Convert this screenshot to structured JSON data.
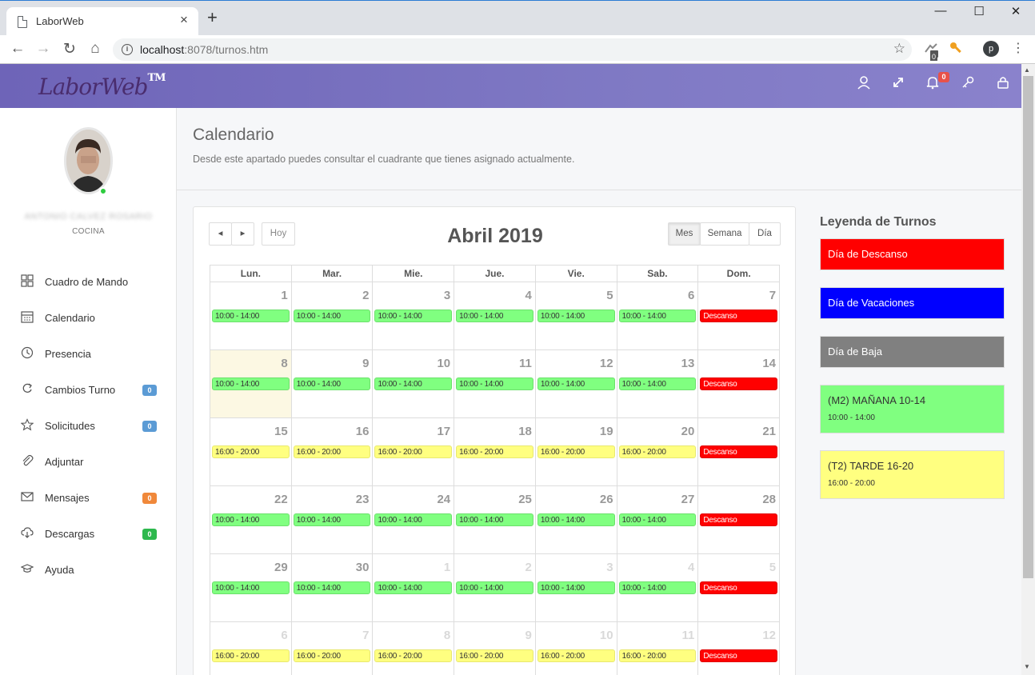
{
  "browser": {
    "tab_title": "LaborWeb",
    "tab_close": "×",
    "new_tab": "+",
    "win_min": "—",
    "win_max": "☐",
    "win_close": "✕",
    "back": "←",
    "forward": "→",
    "reload": "↻",
    "home": "⌂",
    "url_host": "localhost",
    "url_rest": ":8078/turnos.htm",
    "star": "☆",
    "ext_badge": "0",
    "profile_initial": "p",
    "menu": "⋮"
  },
  "header": {
    "logo": "LaborWeb",
    "logo_tm": "TM",
    "notifications_count": "0",
    "icons": [
      "user-icon",
      "expand-icon",
      "bell-icon",
      "key-icon",
      "lock-icon"
    ]
  },
  "sidebar": {
    "user_name": "ANTONIO CALVEZ ROSARIO",
    "user_dept": "COCINA",
    "items": [
      {
        "label": "Cuadro de Mando",
        "icon": "grid-icon"
      },
      {
        "label": "Calendario",
        "icon": "calendar-icon"
      },
      {
        "label": "Presencia",
        "icon": "clock-icon"
      },
      {
        "label": "Cambios Turno",
        "icon": "swap-icon",
        "badge": "0",
        "badge_color": "#5b9bd5"
      },
      {
        "label": "Solicitudes",
        "icon": "star-icon",
        "badge": "0",
        "badge_color": "#5b9bd5"
      },
      {
        "label": "Adjuntar",
        "icon": "paperclip-icon"
      },
      {
        "label": "Mensajes",
        "icon": "envelope-icon",
        "badge": "0",
        "badge_color": "#f0883a"
      },
      {
        "label": "Descargas",
        "icon": "cloud-download-icon",
        "badge": "0",
        "badge_color": "#2db84d"
      },
      {
        "label": "Ayuda",
        "icon": "graduation-icon"
      }
    ]
  },
  "page": {
    "title": "Calendario",
    "subtitle": "Desde este apartado puedes consultar el cuadrante que tienes asignado actualmente."
  },
  "calendar": {
    "title": "Abril 2019",
    "prev": "◂",
    "next": "▸",
    "today_label": "Hoy",
    "views": [
      "Mes",
      "Semana",
      "Día"
    ],
    "active_view": "Mes",
    "weekdays": [
      "Lun.",
      "Mar.",
      "Mie.",
      "Jue.",
      "Vie.",
      "Sab.",
      "Dom."
    ],
    "weeks": [
      [
        {
          "d": "1",
          "ev": "10:00 - 14:00",
          "k": "m"
        },
        {
          "d": "2",
          "ev": "10:00 - 14:00",
          "k": "m"
        },
        {
          "d": "3",
          "ev": "10:00 - 14:00",
          "k": "m"
        },
        {
          "d": "4",
          "ev": "10:00 - 14:00",
          "k": "m"
        },
        {
          "d": "5",
          "ev": "10:00 - 14:00",
          "k": "m"
        },
        {
          "d": "6",
          "ev": "10:00 - 14:00",
          "k": "m"
        },
        {
          "d": "7",
          "ev": "Descanso",
          "k": "d"
        }
      ],
      [
        {
          "d": "8",
          "ev": "10:00 - 14:00",
          "k": "m",
          "today": true
        },
        {
          "d": "9",
          "ev": "10:00 - 14:00",
          "k": "m"
        },
        {
          "d": "10",
          "ev": "10:00 - 14:00",
          "k": "m"
        },
        {
          "d": "11",
          "ev": "10:00 - 14:00",
          "k": "m"
        },
        {
          "d": "12",
          "ev": "10:00 - 14:00",
          "k": "m"
        },
        {
          "d": "13",
          "ev": "10:00 - 14:00",
          "k": "m"
        },
        {
          "d": "14",
          "ev": "Descanso",
          "k": "d"
        }
      ],
      [
        {
          "d": "15",
          "ev": "16:00 - 20:00",
          "k": "t"
        },
        {
          "d": "16",
          "ev": "16:00 - 20:00",
          "k": "t"
        },
        {
          "d": "17",
          "ev": "16:00 - 20:00",
          "k": "t"
        },
        {
          "d": "18",
          "ev": "16:00 - 20:00",
          "k": "t"
        },
        {
          "d": "19",
          "ev": "16:00 - 20:00",
          "k": "t"
        },
        {
          "d": "20",
          "ev": "16:00 - 20:00",
          "k": "t"
        },
        {
          "d": "21",
          "ev": "Descanso",
          "k": "d"
        }
      ],
      [
        {
          "d": "22",
          "ev": "10:00 - 14:00",
          "k": "m"
        },
        {
          "d": "23",
          "ev": "10:00 - 14:00",
          "k": "m"
        },
        {
          "d": "24",
          "ev": "10:00 - 14:00",
          "k": "m"
        },
        {
          "d": "25",
          "ev": "10:00 - 14:00",
          "k": "m"
        },
        {
          "d": "26",
          "ev": "10:00 - 14:00",
          "k": "m"
        },
        {
          "d": "27",
          "ev": "10:00 - 14:00",
          "k": "m"
        },
        {
          "d": "28",
          "ev": "Descanso",
          "k": "d"
        }
      ],
      [
        {
          "d": "29",
          "ev": "10:00 - 14:00",
          "k": "m"
        },
        {
          "d": "30",
          "ev": "10:00 - 14:00",
          "k": "m"
        },
        {
          "d": "1",
          "ev": "10:00 - 14:00",
          "k": "m",
          "other": true
        },
        {
          "d": "2",
          "ev": "10:00 - 14:00",
          "k": "m",
          "other": true
        },
        {
          "d": "3",
          "ev": "10:00 - 14:00",
          "k": "m",
          "other": true
        },
        {
          "d": "4",
          "ev": "10:00 - 14:00",
          "k": "m",
          "other": true
        },
        {
          "d": "5",
          "ev": "Descanso",
          "k": "d",
          "other": true
        }
      ],
      [
        {
          "d": "6",
          "ev": "16:00 - 20:00",
          "k": "t",
          "other": true
        },
        {
          "d": "7",
          "ev": "16:00 - 20:00",
          "k": "t",
          "other": true
        },
        {
          "d": "8",
          "ev": "16:00 - 20:00",
          "k": "t",
          "other": true
        },
        {
          "d": "9",
          "ev": "16:00 - 20:00",
          "k": "t",
          "other": true
        },
        {
          "d": "10",
          "ev": "16:00 - 20:00",
          "k": "t",
          "other": true
        },
        {
          "d": "11",
          "ev": "16:00 - 20:00",
          "k": "t",
          "other": true
        },
        {
          "d": "12",
          "ev": "Descanso",
          "k": "d",
          "other": true
        }
      ]
    ]
  },
  "legend": {
    "title": "Leyenda de Turnos",
    "items": [
      {
        "label": "Día de Descanso",
        "color": "#ff0000",
        "text_color": "#ffffff"
      },
      {
        "label": "Día de Vacaciones",
        "color": "#0000ff",
        "text_color": "#ffffff"
      },
      {
        "label": "Día de Baja",
        "color": "#808080",
        "text_color": "#ffffff"
      },
      {
        "label": "(M2) MAÑANA 10-14",
        "sub": "10:00 - 14:00",
        "color": "#80ff80",
        "text_color": "#333333"
      },
      {
        "label": "(T2) TARDE 16-20",
        "sub": "16:00 - 20:00",
        "color": "#ffff80",
        "text_color": "#333333"
      }
    ]
  },
  "colors": {
    "header_start": "#6e64b8",
    "header_end": "#8a82cc",
    "shift_morning": "#80ff80",
    "shift_afternoon": "#ffff80",
    "rest_day": "#ff0000",
    "today_bg": "#fcf8e3"
  }
}
